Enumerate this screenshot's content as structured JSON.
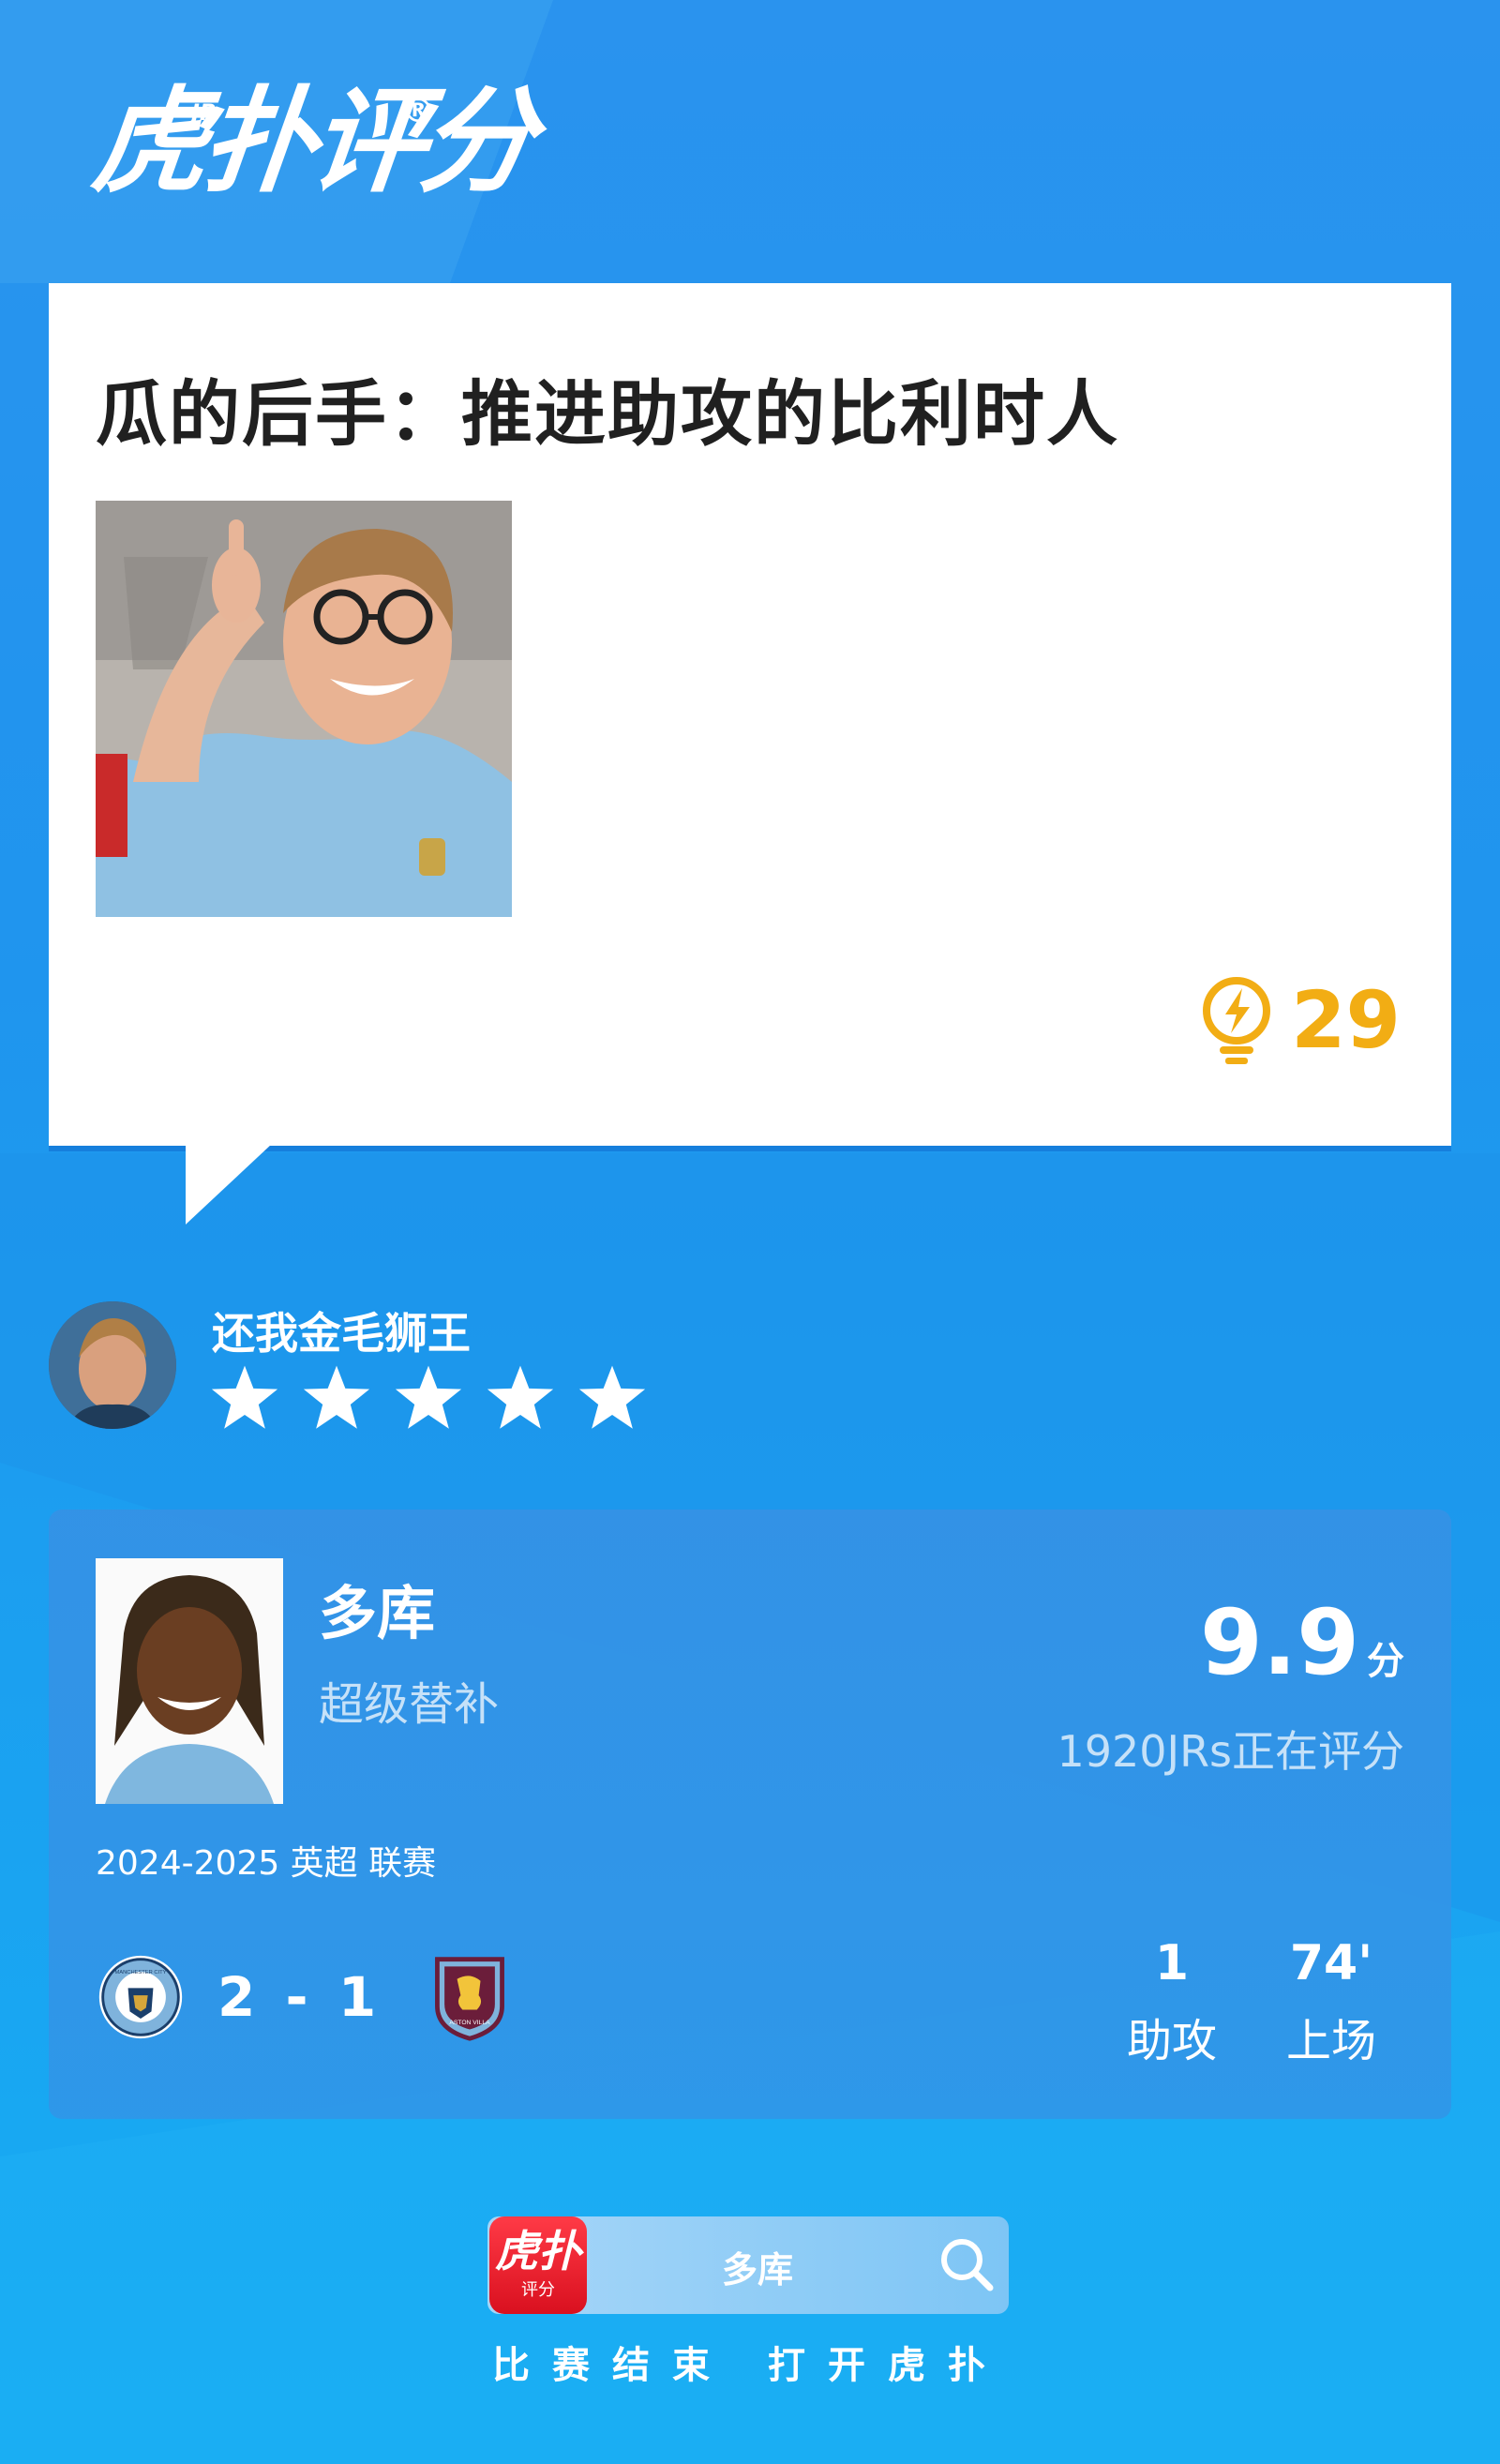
{
  "brand": {
    "logo_text": "虎扑评分",
    "logo_sub": "JR",
    "registered": "®"
  },
  "quote": {
    "title": "瓜的后手：推进助攻的比利时人",
    "likes_count": "29",
    "likes_icon": "lightbulb-icon",
    "accent_color": "#f2ad14"
  },
  "commenter": {
    "name": "还我金毛狮王",
    "rating_stars": 5,
    "rating_max": 5
  },
  "player": {
    "name": "多库",
    "tag": "超级替补",
    "score": "9.9",
    "score_unit": "分",
    "raters_text": "1920JRs正在评分",
    "season": "2024-2025 英超 联赛",
    "result": "2 - 1",
    "home_badge": "manchester-city-badge",
    "away_badge": "aston-villa-badge",
    "home_badge_text": "MANCHESTER CITY",
    "away_badge_text": "ASTON VILLA",
    "stats": [
      {
        "value": "1",
        "label": "助攻"
      },
      {
        "value": "74'",
        "label": "上场"
      }
    ]
  },
  "footer": {
    "app_icon_main": "虎扑",
    "app_icon_sub": "评分",
    "search_text": "多库",
    "caption": "比赛结束 打开虎扑"
  }
}
